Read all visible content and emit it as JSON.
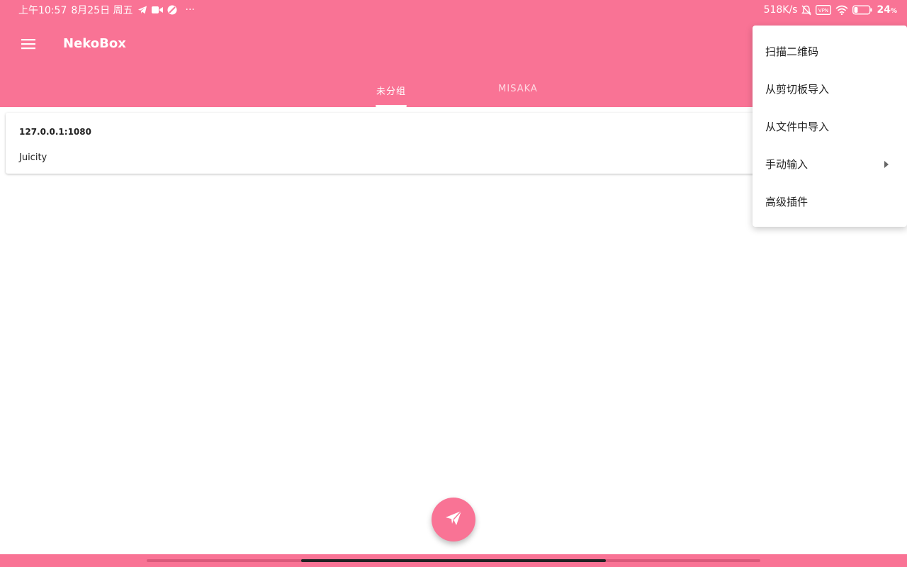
{
  "status_bar": {
    "time": "上午10:57",
    "date": "8月25日 周五",
    "more": "···",
    "speed": "518K/s",
    "vpn_label": "VPN",
    "battery": "24",
    "battery_unit": "%",
    "battery_level": 0.24
  },
  "app_bar": {
    "title": "NekoBox"
  },
  "tabs": [
    {
      "label": "未分组",
      "selected": true
    },
    {
      "label": "MISAKA",
      "selected": false
    }
  ],
  "profiles": [
    {
      "address": "127.0.0.1:1080",
      "type": "Juicity"
    }
  ],
  "menu": {
    "items": [
      {
        "label": "扫描二维码"
      },
      {
        "label": "从剪切板导入"
      },
      {
        "label": "从文件中导入"
      },
      {
        "label": "手动输入",
        "has_submenu": true
      },
      {
        "label": "高级插件"
      }
    ]
  },
  "colors": {
    "accent": "#f97395",
    "background": "#ffffff"
  },
  "icons": {
    "menu": "hamburger-icon",
    "fab": "send-icon"
  }
}
